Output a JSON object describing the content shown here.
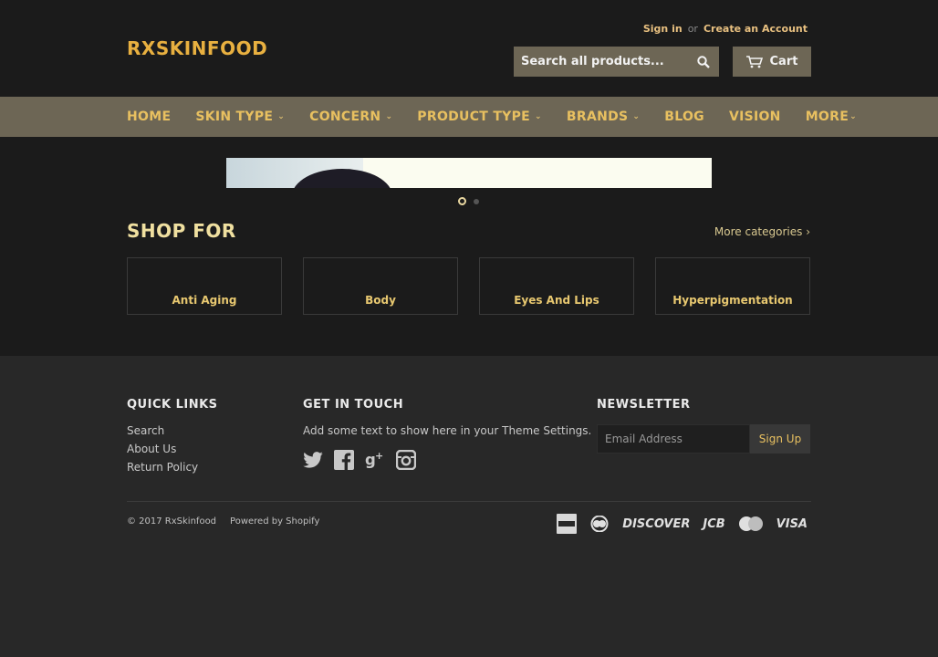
{
  "header": {
    "logo": "RXSKINFOOD",
    "sign_in": "Sign in",
    "or": "or",
    "create_account": "Create an Account",
    "search_placeholder": "Search all products...",
    "cart_label": "Cart"
  },
  "nav": {
    "items": [
      {
        "label": "HOME",
        "dropdown": false
      },
      {
        "label": "SKIN TYPE",
        "dropdown": true
      },
      {
        "label": "CONCERN",
        "dropdown": true
      },
      {
        "label": "PRODUCT TYPE",
        "dropdown": true
      },
      {
        "label": "BRANDS",
        "dropdown": true
      },
      {
        "label": "BLOG",
        "dropdown": false
      },
      {
        "label": "VISION",
        "dropdown": false
      },
      {
        "label": "MORE",
        "dropdown": true
      }
    ]
  },
  "slider": {
    "active_index": 0,
    "count": 2
  },
  "shop": {
    "title": "SHOP FOR",
    "more_link": "More categories ›",
    "categories": [
      "Anti Aging",
      "Body",
      "Eyes And Lips",
      "Hyperpigmentation"
    ]
  },
  "footer": {
    "quick_links": {
      "heading": "QUICK LINKS",
      "links": [
        "Search",
        "About Us",
        "Return Policy"
      ]
    },
    "get_in_touch": {
      "heading": "GET IN TOUCH",
      "text": "Add some text to show here in your Theme Settings.",
      "social": [
        "twitter-icon",
        "facebook-icon",
        "google-plus-icon",
        "instagram-icon"
      ]
    },
    "newsletter": {
      "heading": "NEWSLETTER",
      "placeholder": "Email Address",
      "button": "Sign Up"
    },
    "copyright": "© 2017 RxSkinfood",
    "powered_by": "Powered by Shopify",
    "payments": [
      "DISCOVER",
      "JCB",
      "VISA"
    ]
  },
  "colors": {
    "background": "#1b1b1b",
    "nav_bg": "#6d6655",
    "accent": "#e8b040",
    "footer_bg": "#282828"
  }
}
